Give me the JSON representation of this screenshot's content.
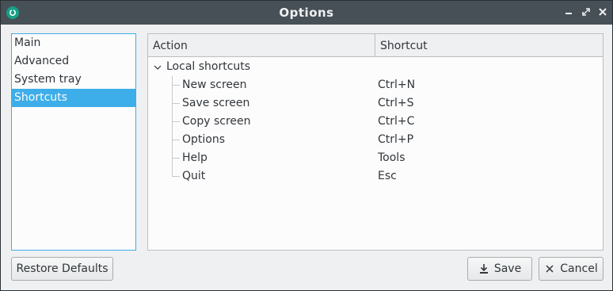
{
  "window": {
    "title": "Options",
    "app_icon": "app-logo-icon",
    "controls": [
      "minimize-icon",
      "maximize-icon",
      "close-icon"
    ]
  },
  "sidebar": {
    "items": [
      {
        "label": "Main",
        "selected": false
      },
      {
        "label": "Advanced",
        "selected": false
      },
      {
        "label": "System tray",
        "selected": false
      },
      {
        "label": "Shortcuts",
        "selected": true
      }
    ]
  },
  "shortcuts": {
    "columns": {
      "action": "Action",
      "shortcut": "Shortcut"
    },
    "group": {
      "label": "Local shortcuts",
      "expanded": true
    },
    "rows": [
      {
        "action": "New screen",
        "shortcut": "Ctrl+N"
      },
      {
        "action": "Save screen",
        "shortcut": "Ctrl+S"
      },
      {
        "action": "Copy screen",
        "shortcut": "Ctrl+C"
      },
      {
        "action": "Options",
        "shortcut": "Ctrl+P"
      },
      {
        "action": "Help",
        "shortcut": "Tools"
      },
      {
        "action": "Quit",
        "shortcut": "Esc"
      }
    ]
  },
  "buttons": {
    "restore_defaults": "Restore Defaults",
    "save": "Save",
    "cancel": "Cancel"
  },
  "colors": {
    "titlebar": "#475057",
    "accent": "#3daee9",
    "background": "#eff0f1"
  }
}
